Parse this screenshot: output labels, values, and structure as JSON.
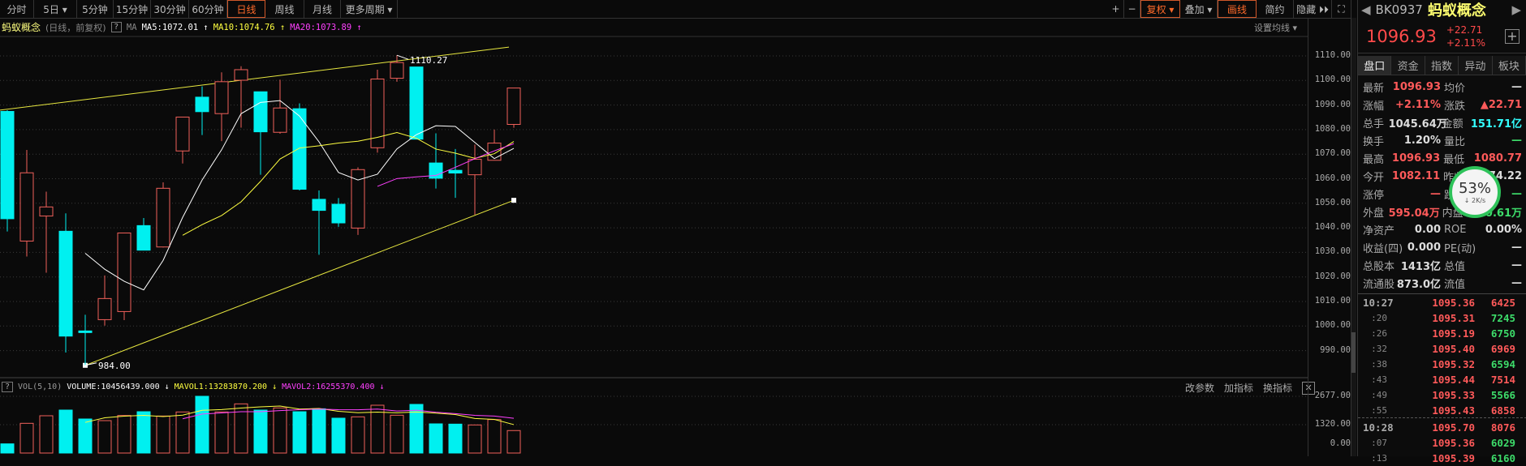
{
  "toolbar": {
    "left": [
      "分时",
      "5日 ▾",
      "5分钟",
      "15分钟",
      "30分钟",
      "60分钟",
      "日线",
      "周线",
      "月线",
      "更多周期 ▾"
    ],
    "active": "日线",
    "zoom_in": "+",
    "zoom_out": "−",
    "fuquan": "复权 ▾",
    "overlay": "叠加 ▾",
    "draw": "画线",
    "simple": "简约",
    "hide": "隐藏 ⏵⏵",
    "fullscreen": "⛶"
  },
  "title": {
    "name": "蚂蚁概念",
    "mode": "(日线，前复权)",
    "help": "?",
    "ma_label": "MA",
    "ma5": "MA5:1072.01 ↑",
    "ma10": "MA10:1074.76 ↑",
    "ma20": "MA20:1073.89 ↑",
    "ma_setting": "设置均线 ▾"
  },
  "colors": {
    "up": "#f0605a",
    "down": "#00f0f0",
    "ma5": "#ffffff",
    "ma10": "#ffff40",
    "ma20": "#ff40ff",
    "trend": "#e8e840",
    "grid": "#3a3a3a"
  },
  "chart_data": {
    "type": "candlestick",
    "price_ticks": [
      "1110.00",
      "1100.00",
      "1090.00",
      "1080.00",
      "1070.00",
      "1060.00",
      "1050.00",
      "1040.00",
      "1030.00",
      "1020.00",
      "1010.00",
      "1000.00",
      "990.00"
    ],
    "ohlc": [
      [
        1087.4,
        1087.9,
        1038.5,
        1043.7
      ],
      [
        1034.6,
        1071.7,
        1028.3,
        1062.4
      ],
      [
        1044.8,
        1054.7,
        1021.7,
        1048.5
      ],
      [
        1038.6,
        1045.9,
        989.2,
        995.9
      ],
      [
        998.0,
        1004.6,
        984.0,
        997.7
      ],
      [
        1002.6,
        1020.6,
        1000.2,
        1011.2
      ],
      [
        1005.9,
        1038.0,
        1002.4,
        1037.9
      ],
      [
        1040.9,
        1044.0,
        1030.9,
        1030.9
      ],
      [
        1032.2,
        1058.5,
        1032.0,
        1056.1
      ],
      [
        1071.3,
        1085.1,
        1066.2,
        1085.1
      ],
      [
        1093.2,
        1097.6,
        1077.8,
        1087.3
      ],
      [
        1086.5,
        1103.3,
        1075.3,
        1099.5
      ],
      [
        1100.1,
        1105.8,
        1080.8,
        1104.4
      ],
      [
        1095.4,
        1095.4,
        1061.6,
        1079.1
      ],
      [
        1078.9,
        1100.3,
        1078.3,
        1088.8
      ],
      [
        1088.5,
        1090.7,
        1055.2,
        1055.7
      ],
      [
        1051.6,
        1055.2,
        1029.0,
        1047.1
      ],
      [
        1049.6,
        1052.1,
        1040.4,
        1042.0
      ],
      [
        1039.9,
        1064.6,
        1037.1,
        1063.7
      ],
      [
        1072.6,
        1104.4,
        1070.6,
        1100.6
      ],
      [
        1100.9,
        1110.27,
        1099.5,
        1107.3
      ],
      [
        1105.5,
        1105.5,
        1076.1,
        1076.1
      ],
      [
        1066.4,
        1078.5,
        1056.0,
        1060.2
      ],
      [
        1063.4,
        1072.1,
        1052.2,
        1062.3
      ],
      [
        1061.6,
        1073.9,
        1045.3,
        1067.9
      ],
      [
        1067.5,
        1080.0,
        1067.5,
        1074.5
      ],
      [
        1082.11,
        1096.93,
        1080.77,
        1096.93
      ]
    ],
    "volume": [
      427,
      1383,
      1735,
      1999,
      1584,
      1508,
      1747,
      1923,
      1722,
      1911,
      2640,
      1911,
      2288,
      1999,
      2099,
      1923,
      2061,
      1622,
      1684,
      2225,
      1760,
      2263,
      1358,
      1345,
      1307,
      1559,
      1046
    ],
    "volume_ticks": [
      "2677.00",
      "1320.00",
      "0.00"
    ],
    "high_label": "1110.27",
    "low_label": "984.00",
    "trendlines": [
      {
        "from": [
          -0.4,
          1087.9
        ],
        "to": [
          25.75,
          1113.6
        ]
      },
      {
        "from": [
          4,
          984.0
        ],
        "to": [
          26,
          1051.2
        ]
      }
    ]
  },
  "volume_header": {
    "help": "?",
    "name": "VOL(5,10)",
    "volume": "VOLUME:10456439.000 ↓",
    "mavol1": "MAVOL1:13283870.200 ↓",
    "mavol2": "MAVOL2:16255370.400 ↓"
  },
  "volume_tools": {
    "edit": "改参数",
    "add": "加指标",
    "switch": "换指标",
    "close": "✕"
  },
  "panel": {
    "code": "BK0937",
    "name": "蚂蚁概念",
    "price": "1096.93",
    "change": "+22.71",
    "change_pct": "+2.11%",
    "add": "+",
    "tabs": [
      "盘口",
      "资金",
      "指数",
      "异动",
      "板块"
    ],
    "quote": [
      {
        "l": "最新",
        "v": "1096.93",
        "vc": "red",
        "l2": "均价",
        "v2": "—",
        "v2c": "white"
      },
      {
        "l": "涨幅",
        "v": "+2.11%",
        "vc": "red",
        "l2": "涨跌",
        "v2": "▲22.71",
        "v2c": "red"
      },
      {
        "l": "总手",
        "v": "1045.64万",
        "vc": "white",
        "l2": "金额",
        "v2": "151.71亿",
        "v2c": "cyan"
      },
      {
        "l": "换手",
        "v": "1.20%",
        "vc": "white",
        "l2": "量比",
        "v2": "—",
        "v2c": "green"
      },
      {
        "l": "最高",
        "v": "1096.93",
        "vc": "red",
        "l2": "最低",
        "v2": "1080.77",
        "v2c": "red"
      },
      {
        "l": "今开",
        "v": "1082.11",
        "vc": "red",
        "l2": "昨收",
        "v2": "1074.22",
        "v2c": "white"
      },
      {
        "l": "涨停",
        "v": "—",
        "vc": "red",
        "l2": "跌停",
        "v2": "—",
        "v2c": "green"
      },
      {
        "l": "外盘",
        "v": "595.04万",
        "vc": "red",
        "l2": "内盘",
        "v2": "450.61万",
        "v2c": "green"
      },
      {
        "l": "净资产",
        "v": "0.00",
        "vc": "white",
        "l2": "ROE",
        "v2": "0.00%",
        "v2c": "white"
      },
      {
        "l": "收益(四)",
        "v": "0.000",
        "vc": "white",
        "l2": "PE(动)",
        "v2": "—",
        "v2c": "white"
      },
      {
        "l": "总股本",
        "v": "1413亿",
        "vc": "white",
        "l2": "总值",
        "v2": "—",
        "v2c": "white"
      },
      {
        "l": "流通股",
        "v": "873.0亿",
        "vc": "white",
        "l2": "流值",
        "v2": "—",
        "v2c": "white"
      }
    ],
    "ticks": [
      {
        "t": "10:27",
        "p": "1095.36",
        "v": "6425",
        "c": "red"
      },
      {
        "t": ":20",
        "p": "1095.31",
        "v": "7245",
        "c": "green"
      },
      {
        "t": ":26",
        "p": "1095.19",
        "v": "6750",
        "c": "green"
      },
      {
        "t": ":32",
        "p": "1095.40",
        "v": "6969",
        "c": "red"
      },
      {
        "t": ":38",
        "p": "1095.32",
        "v": "6594",
        "c": "green"
      },
      {
        "t": ":43",
        "p": "1095.44",
        "v": "7514",
        "c": "red"
      },
      {
        "t": ":49",
        "p": "1095.33",
        "v": "5566",
        "c": "green"
      },
      {
        "t": ":55",
        "p": "1095.43",
        "v": "6858",
        "c": "red"
      },
      {
        "t": "10:28",
        "p": "1095.70",
        "v": "8076",
        "c": "red"
      },
      {
        "t": ":07",
        "p": "1095.36",
        "v": "6029",
        "c": "green"
      },
      {
        "t": ":13",
        "p": "1095.39",
        "v": "6160",
        "c": "green"
      }
    ],
    "speed": {
      "pct": "53%",
      "rate": "↓ 2K/s",
      "progress": 53
    }
  }
}
